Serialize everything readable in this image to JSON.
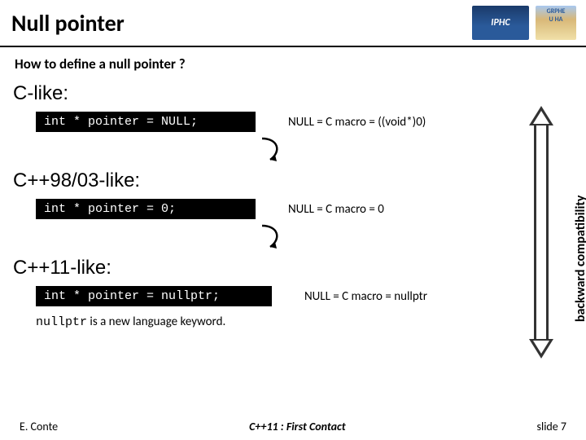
{
  "header": {
    "title": "Null pointer",
    "logo1": "IPHC",
    "logo2a": "GRPHE",
    "logo2b": "U HA"
  },
  "subtitle": "How to define a null pointer ?",
  "sections": {
    "clike": {
      "heading": "C-like:",
      "code": "int * pointer = NULL;",
      "explain": "NULL = C macro  = ((void*)0)"
    },
    "cpp98": {
      "heading": "C++98/03-like:",
      "code": "int * pointer = 0;",
      "explain": "NULL = C macro  = 0"
    },
    "cpp11": {
      "heading": "C++11-like:",
      "code": "int * pointer = nullptr;",
      "explain": "NULL = C macro  = nullptr"
    }
  },
  "keyword_note": {
    "mono": "nullptr",
    "rest": " is a new language keyword."
  },
  "right_label": "backward compatibility",
  "footer": {
    "left": "E. Conte",
    "center": "C++11 : First Contact",
    "right": "slide 7"
  }
}
